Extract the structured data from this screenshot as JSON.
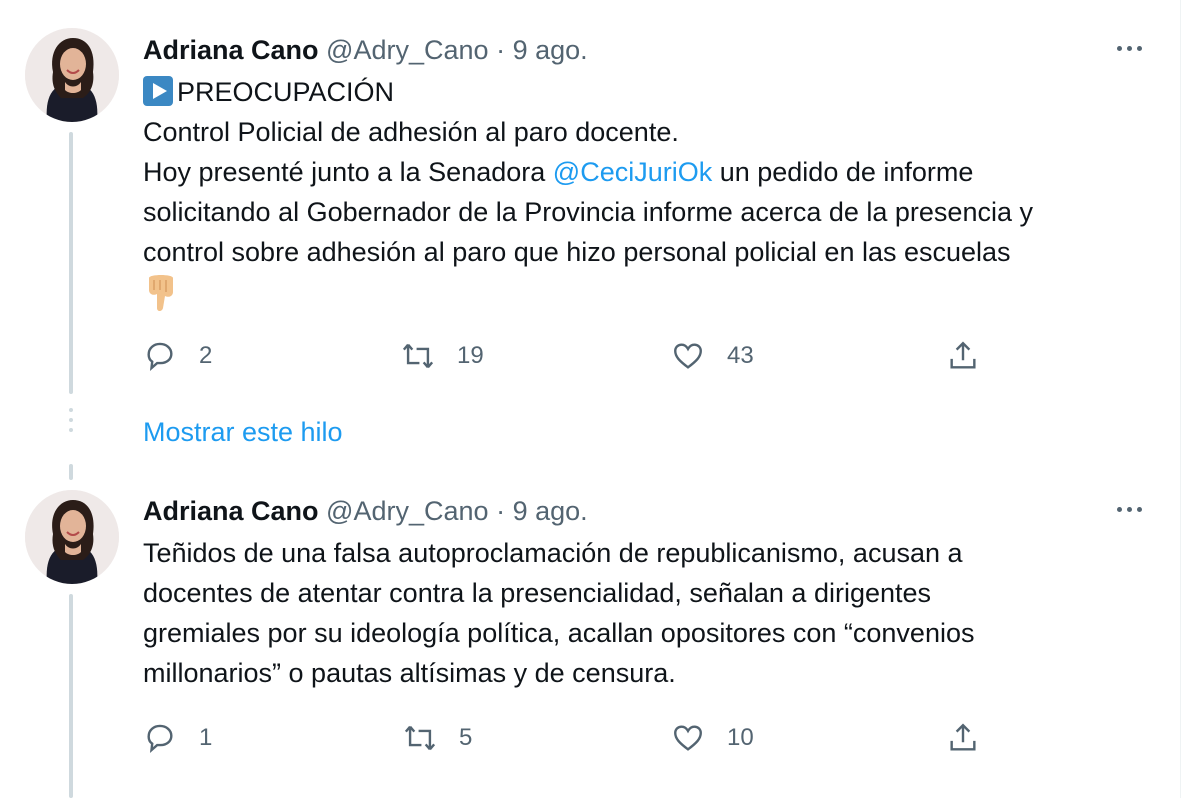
{
  "tweets": [
    {
      "name": "Adriana Cano",
      "handle": "@Adry_Cano",
      "separator": "·",
      "date": "9 ago.",
      "badge_icon": "play-button-icon",
      "headline": "PREOCUPACIÓN",
      "line1": "Control Policial de adhesión al paro docente.",
      "line2_before": "Hoy presenté junto a la Senadora ",
      "mention": "@CeciJuriOk",
      "line2_after": " un pedido de informe",
      "line3": "solicitando al Gobernador de la Provincia informe acerca de la presencia y",
      "line4": "control sobre adhesión al paro que hizo personal policial en las escuelas",
      "emoji": "pointing-down-hand-icon",
      "replies": "2",
      "retweets": "19",
      "likes": "43"
    },
    {
      "name": "Adriana Cano",
      "handle": "@Adry_Cano",
      "separator": "·",
      "date": "9 ago.",
      "line1": "Teñidos de una falsa autoproclamación de republicanismo, acusan a",
      "line2": "docentes de atentar contra la presencialidad, señalan a dirigentes",
      "line3": "gremiales por su ideología política, acallan opositores con “convenios",
      "line4": "millonarios” o pautas altísimas y de censura.",
      "replies": "1",
      "retweets": "5",
      "likes": "10"
    }
  ],
  "show_thread": "Mostrar este hilo",
  "colors": {
    "link": "#1d9bf0",
    "muted": "#536471",
    "text": "#0f1419",
    "line": "#cfd9de"
  }
}
